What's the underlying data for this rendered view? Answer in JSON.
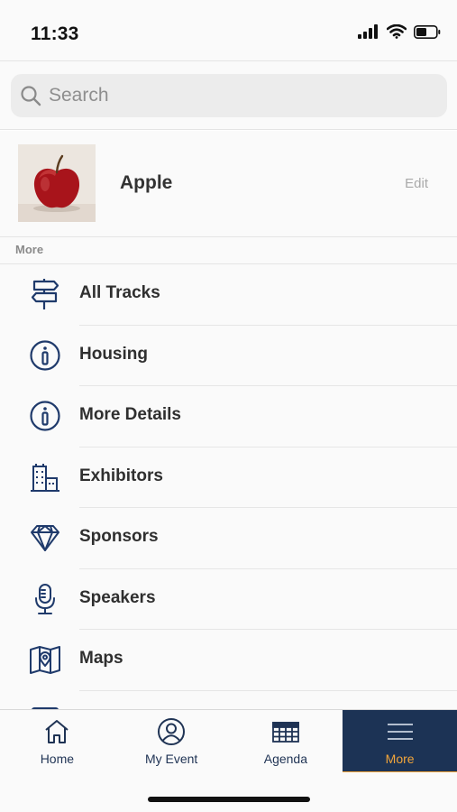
{
  "status_bar": {
    "time": "11:33"
  },
  "search": {
    "placeholder": "Search"
  },
  "profile": {
    "name": "Apple",
    "edit_label": "Edit"
  },
  "section": {
    "label": "More"
  },
  "menu": {
    "items": [
      {
        "label": "All Tracks",
        "icon": "signpost-icon"
      },
      {
        "label": "Housing",
        "icon": "info-icon"
      },
      {
        "label": "More Details",
        "icon": "info-icon"
      },
      {
        "label": "Exhibitors",
        "icon": "building-icon"
      },
      {
        "label": "Sponsors",
        "icon": "diamond-icon"
      },
      {
        "label": "Speakers",
        "icon": "microphone-icon"
      },
      {
        "label": "Maps",
        "icon": "map-icon"
      }
    ]
  },
  "tab_bar": {
    "tabs": [
      {
        "label": "Home",
        "icon": "home-icon"
      },
      {
        "label": "My Event",
        "icon": "user-circle-icon"
      },
      {
        "label": "Agenda",
        "icon": "calendar-grid-icon"
      },
      {
        "label": "More",
        "icon": "hamburger-icon",
        "active": true
      }
    ]
  },
  "colors": {
    "navy": "#1c3355",
    "accent": "#f1a53b",
    "icon": "#1f3a6b"
  }
}
